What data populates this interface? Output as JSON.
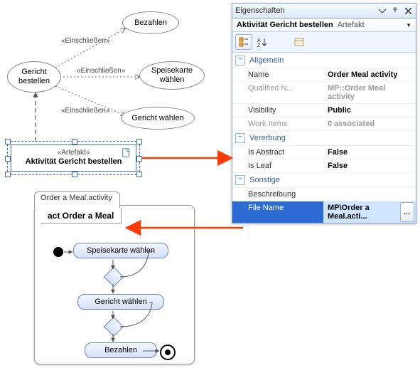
{
  "usecase": {
    "main": "Gericht\nbestellen",
    "bezahlen": "Bezahlen",
    "speisekarte": "Speisekarte\nwählen",
    "gericht": "Gericht wählen",
    "include": "«Einschließen»"
  },
  "artifact": {
    "stereotype": "«Artefakt»",
    "name": "Aktivität Gericht bestellen"
  },
  "activity": {
    "file_tab": "Order a Meal.activity",
    "heading": "act Order a Meal",
    "n1": "Speisekarte wählen",
    "n2": "Gericht wählen",
    "n3": "Bezahlen"
  },
  "props": {
    "window_title": "Eigenschaften",
    "selection_name": "Aktivität Gericht bestellen",
    "selection_type": "Artefakt",
    "cat_general": "Allgemein",
    "cat_inherit": "Vererbung",
    "cat_other": "Sonstige",
    "rows": {
      "name_k": "Name",
      "name_v": "Order Meal activity",
      "qname_k": "Qualified N...",
      "qname_v": "MP::Order Meal activity",
      "vis_k": "Visibility",
      "vis_v": "Public",
      "work_k": "Work Items",
      "work_v": "0 associated",
      "abs_k": "Is Abstract",
      "abs_v": "False",
      "leaf_k": "Is Leaf",
      "leaf_v": "False",
      "desc_k": "Beschreibung",
      "desc_v": "",
      "file_k": "File Name",
      "file_v": "MP\\Order a Meal.acti..."
    }
  }
}
